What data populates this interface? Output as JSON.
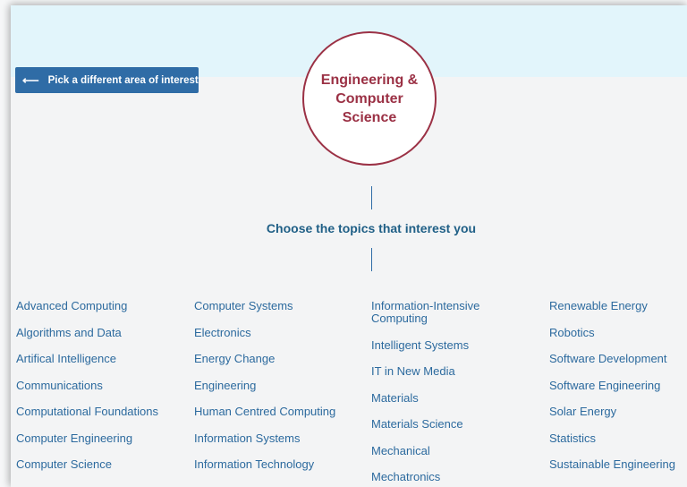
{
  "back_button": {
    "label": "Pick a different area of interest",
    "icon": "arrow-left-icon"
  },
  "area": {
    "title": "Engineering & Computer Science",
    "accent_color": "#9b3145"
  },
  "topics_heading": "Choose the topics that interest you",
  "topics": {
    "column1": [
      "Advanced Computing",
      "Algorithms and Data",
      "Artifical Intelligence",
      "Communications",
      "Computational Foundations",
      "Computer Engineering",
      "Computer Science"
    ],
    "column2": [
      "Computer Systems",
      "Electronics",
      "Energy Change",
      "Engineering",
      "Human Centred Computing",
      "Information Systems",
      "Information Technology"
    ],
    "column3": [
      "Information-Intensive Computing",
      "Intelligent Systems",
      "IT in New Media",
      "Materials",
      "Materials Science",
      "Mechanical",
      "Mechatronics"
    ],
    "column4": [
      "Renewable Energy",
      "Robotics",
      "Software Development",
      "Software Engineering",
      "Solar Energy",
      "Statistics",
      "Sustainable Engineering"
    ]
  },
  "colors": {
    "header_band": "#e2f5fb",
    "button": "#2f6ca6",
    "link": "#2c6a9e",
    "heading": "#1f5f86"
  }
}
